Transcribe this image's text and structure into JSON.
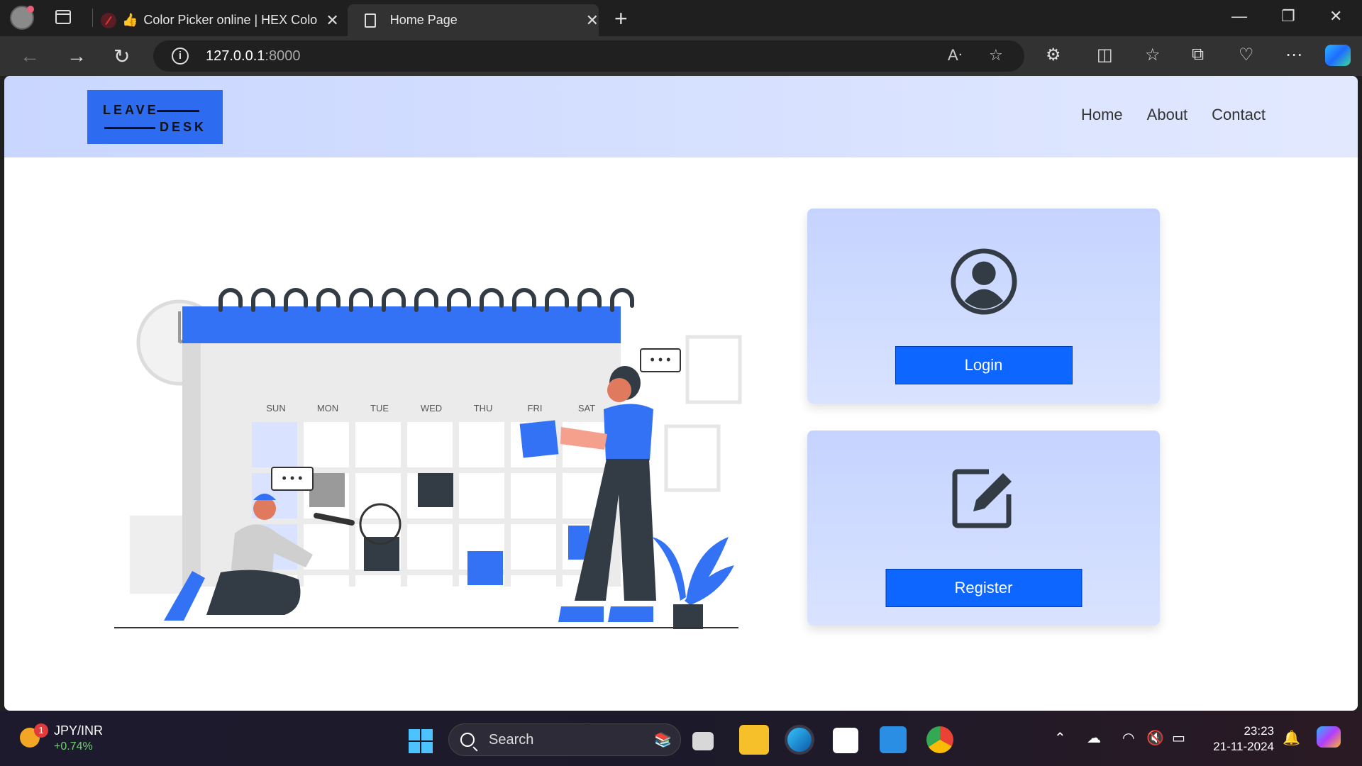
{
  "browser": {
    "tabs": [
      {
        "title": "Color Picker online | HEX Colo",
        "active": false
      },
      {
        "title": "Home Page",
        "active": true
      }
    ],
    "url_host": "127.0.0.1",
    "url_port": ":8000"
  },
  "site": {
    "logo_line1": "LEAVE",
    "logo_line2": "DESK",
    "nav": [
      "Home",
      "About",
      "Contact"
    ],
    "login_label": "Login",
    "register_label": "Register",
    "calendar_days": [
      "SUN",
      "MON",
      "TUE",
      "WED",
      "THU",
      "FRI",
      "SAT"
    ]
  },
  "taskbar": {
    "ticker_symbol": "JPY/INR",
    "ticker_change": "+0.74%",
    "ticker_badge": "1",
    "search_placeholder": "Search",
    "time": "23:23",
    "date": "21-11-2024"
  },
  "colors": {
    "brand_blue": "#0d66ff",
    "header_gradient_start": "#c9d6ff",
    "card_bg": "#c5d3ff"
  }
}
